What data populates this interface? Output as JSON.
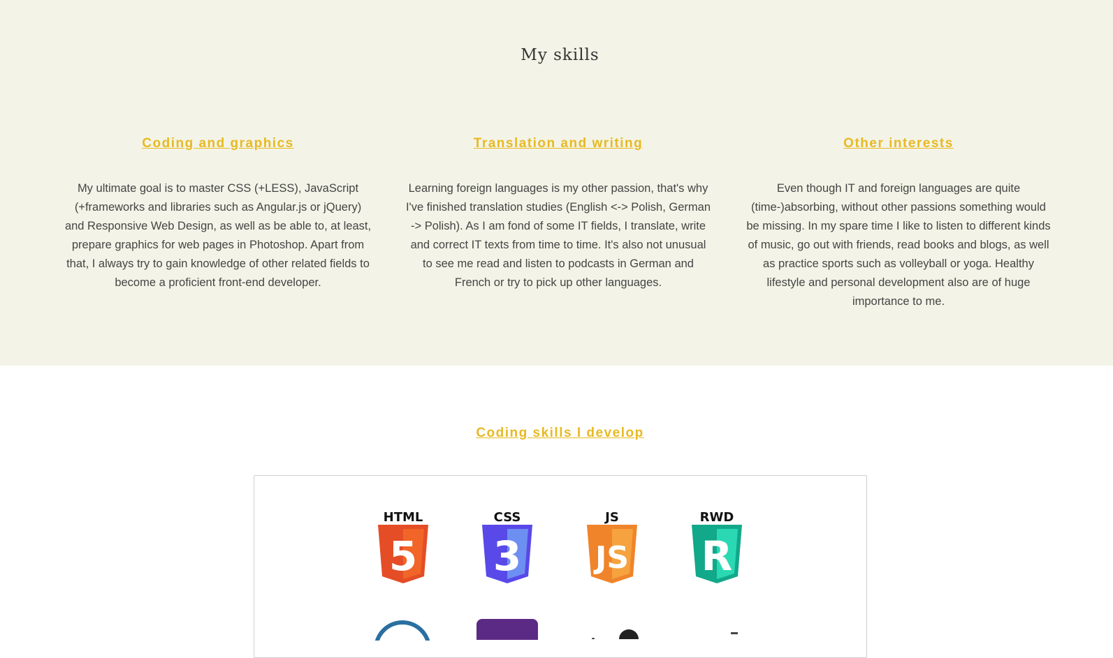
{
  "skills": {
    "title": "My skills",
    "columns": [
      {
        "heading": "Coding and graphics",
        "text": "My ultimate goal is to master CSS (+LESS), JavaScript (+frameworks and libraries such as Angular.js or jQuery) and Responsive Web Design, as well as be able to, at least, prepare graphics for web pages in Photoshop. Apart from that, I always try to gain knowledge of other related fields to become a proficient front-end developer."
      },
      {
        "heading": "Translation and writing",
        "text": "Learning foreign languages is my other passion, that's why I've finished translation studies (English <-> Polish, German -> Polish). As I am fond of some IT fields, I translate, write and correct IT texts from time to time. It's also not unusual to see me read and listen to podcasts in German and French or try to pick up other languages."
      },
      {
        "heading": "Other interests",
        "text": "Even though IT and foreign languages are quite (time-)absorbing, without other passions something would be missing. In my spare time I like to listen to different kinds of music, go out with friends, read books and blogs, as well as practice sports such as volleyball or yoga. Healthy lifestyle and personal development also are of huge importance to me."
      }
    ]
  },
  "coding": {
    "heading": "Coding skills I develop",
    "logos": [
      {
        "label": "HTML",
        "glyph": "5",
        "icon": "html5-logo-icon",
        "color": "#e44d26",
        "light": "#f16529"
      },
      {
        "label": "CSS",
        "glyph": "3",
        "icon": "css3-logo-icon",
        "color": "#5849e8",
        "light": "#6d8ff2"
      },
      {
        "label": "JS",
        "glyph": "JS",
        "icon": "js-logo-icon",
        "color": "#f0842a",
        "light": "#f5a23f"
      },
      {
        "label": "RWD",
        "glyph": "R",
        "icon": "rwd-logo-icon",
        "color": "#12a88a",
        "light": "#2ad9b3"
      }
    ]
  },
  "colors": {
    "accent": "#e8b923",
    "section_bg": "#f3f4e7",
    "text": "#444444"
  }
}
